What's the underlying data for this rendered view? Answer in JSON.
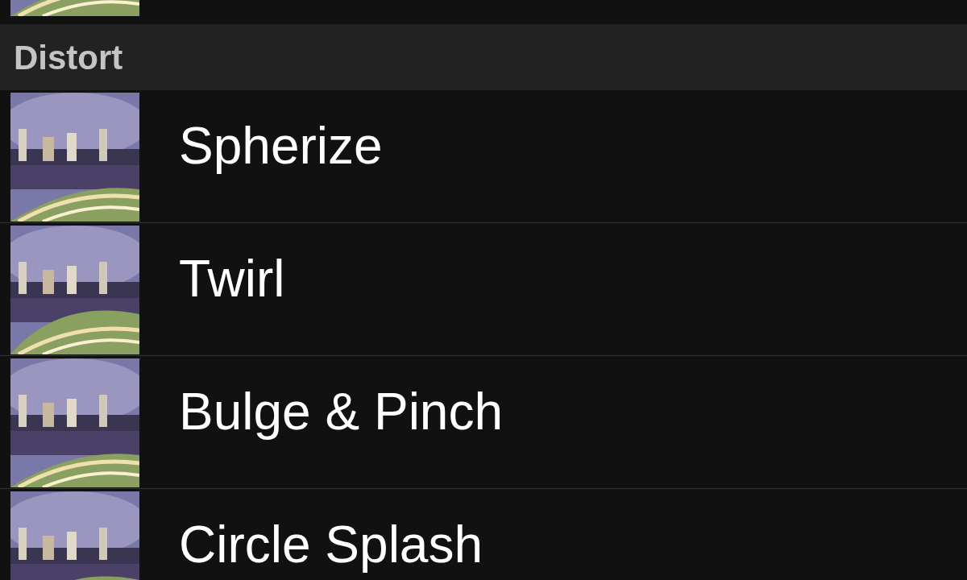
{
  "section": {
    "title": "Distort",
    "items": [
      {
        "label": "Spherize"
      },
      {
        "label": "Twirl"
      },
      {
        "label": "Bulge & Pinch"
      },
      {
        "label": "Circle Splash"
      }
    ]
  }
}
